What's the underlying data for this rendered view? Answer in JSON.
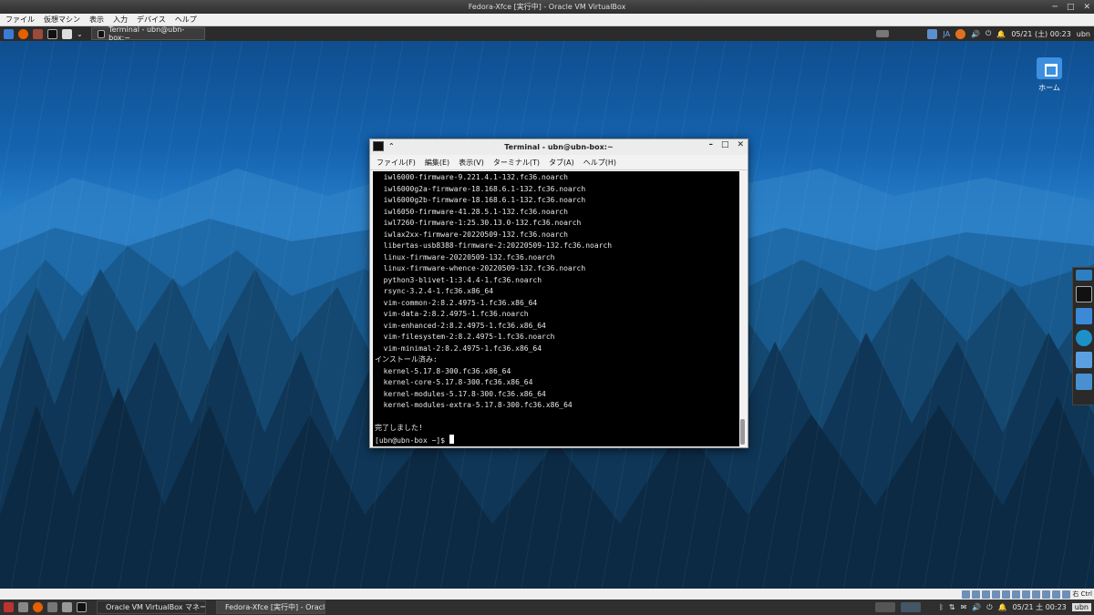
{
  "host": {
    "title": "Fedora-Xfce [実行中] - Oracle VM VirtualBox",
    "menu": [
      "ファイル",
      "仮想マシン",
      "表示",
      "入力",
      "デバイス",
      "ヘルプ"
    ],
    "status_right": "右 Ctrl"
  },
  "guest_panel": {
    "task_label": "Terminal - ubn@ubn-box:~",
    "lang": "JA",
    "clock": "05/21 (土) 00:23",
    "user": "ubn"
  },
  "desktop": {
    "home_label": "ホーム"
  },
  "terminal": {
    "title": "Terminal - ubn@ubn-box:~",
    "menu": [
      "ファイル(F)",
      "編集(E)",
      "表示(V)",
      "ターミナル(T)",
      "タブ(A)",
      "ヘルプ(H)"
    ],
    "lines": [
      "  iwl6000-firmware-9.221.4.1-132.fc36.noarch",
      "  iwl6000g2a-firmware-18.168.6.1-132.fc36.noarch",
      "  iwl6000g2b-firmware-18.168.6.1-132.fc36.noarch",
      "  iwl6050-firmware-41.28.5.1-132.fc36.noarch",
      "  iwl7260-firmware-1:25.30.13.0-132.fc36.noarch",
      "  iwlax2xx-firmware-20220509-132.fc36.noarch",
      "  libertas-usb8388-firmware-2:20220509-132.fc36.noarch",
      "  linux-firmware-20220509-132.fc36.noarch",
      "  linux-firmware-whence-20220509-132.fc36.noarch",
      "  python3-blivet-1:3.4.4-1.fc36.noarch",
      "  rsync-3.2.4-1.fc36.x86_64",
      "  vim-common-2:8.2.4975-1.fc36.x86_64",
      "  vim-data-2:8.2.4975-1.fc36.noarch",
      "  vim-enhanced-2:8.2.4975-1.fc36.x86_64",
      "  vim-filesystem-2:8.2.4975-1.fc36.noarch",
      "  vim-minimal-2:8.2.4975-1.fc36.x86_64",
      "インストール済み:",
      "  kernel-5.17.8-300.fc36.x86_64",
      "  kernel-core-5.17.8-300.fc36.x86_64",
      "  kernel-modules-5.17.8-300.fc36.x86_64",
      "  kernel-modules-extra-5.17.8-300.fc36.x86_64",
      "",
      "完了しました!"
    ],
    "prompt": "[ubn@ubn-box ~]$ "
  },
  "host_taskbar": {
    "tasks": [
      "Oracle VM VirtualBox マネー...",
      "Fedora-Xfce [実行中] - Oracl..."
    ],
    "clock": "05/21 土 00:23",
    "user": "ubn"
  }
}
